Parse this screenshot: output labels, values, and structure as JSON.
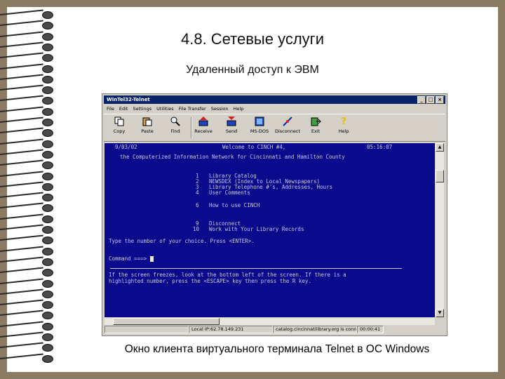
{
  "slide": {
    "title": "4.8. Сетевые услуги",
    "subtitle": "Удаленный доступ к ЭВМ",
    "caption": "Окно клиента виртуального терминала Telnet в ОС Windows"
  },
  "window": {
    "title": "WinTel32-Telnet",
    "buttons": [
      "_",
      "□",
      "×"
    ],
    "menu": [
      "File",
      "Edit",
      "Settings",
      "Utilities",
      "File Transfer",
      "Session",
      "Help"
    ],
    "toolbar": [
      {
        "label": "Copy",
        "icon": "copy-icon"
      },
      {
        "label": "Paste",
        "icon": "paste-icon"
      },
      {
        "label": "Find",
        "icon": "find-icon"
      },
      {
        "label": "Receive",
        "icon": "receive-icon"
      },
      {
        "label": "Send",
        "icon": "send-icon"
      },
      {
        "label": "MS-DOS",
        "icon": "ms-dos-icon"
      },
      {
        "label": "Disconnect",
        "icon": "disconnect-icon"
      },
      {
        "label": "Exit",
        "icon": "exit-icon"
      },
      {
        "label": "Help",
        "icon": "help-icon"
      }
    ]
  },
  "terminal": {
    "date": "9/03/02",
    "welcome": "Welcome to CINCH #4,",
    "time": "05:16:07",
    "tagline": "the Computerized Information Network for Cincinnati and Hamilton County",
    "menu_items": [
      {
        "num": "1",
        "text": "Library Catalog"
      },
      {
        "num": "2",
        "text": "NEWSDEX (Index to Local Newspapers)"
      },
      {
        "num": "3",
        "text": "Library Telephone #'s, Addresses, Hours"
      },
      {
        "num": "4",
        "text": "User Comments"
      },
      {
        "num": "6",
        "text": "How to use CINCH"
      },
      {
        "num": "9",
        "text": "Disconnect"
      },
      {
        "num": "10",
        "text": "Work with Your Library Records"
      }
    ],
    "prompt": "Type the number of your choice. Press <ENTER>.",
    "command_label": "Command ===>",
    "help_line1": "If the screen freezes, look at the bottom left of the screen. If there is a",
    "help_line2": "highlighted number, press the <ESCAPE> key then press the R key."
  },
  "statusbar": {
    "local_ip": "Local IP:62.78.149.231",
    "host": "catalog.cincinnatilibrary.org is conne",
    "timer": "00:00:41"
  }
}
